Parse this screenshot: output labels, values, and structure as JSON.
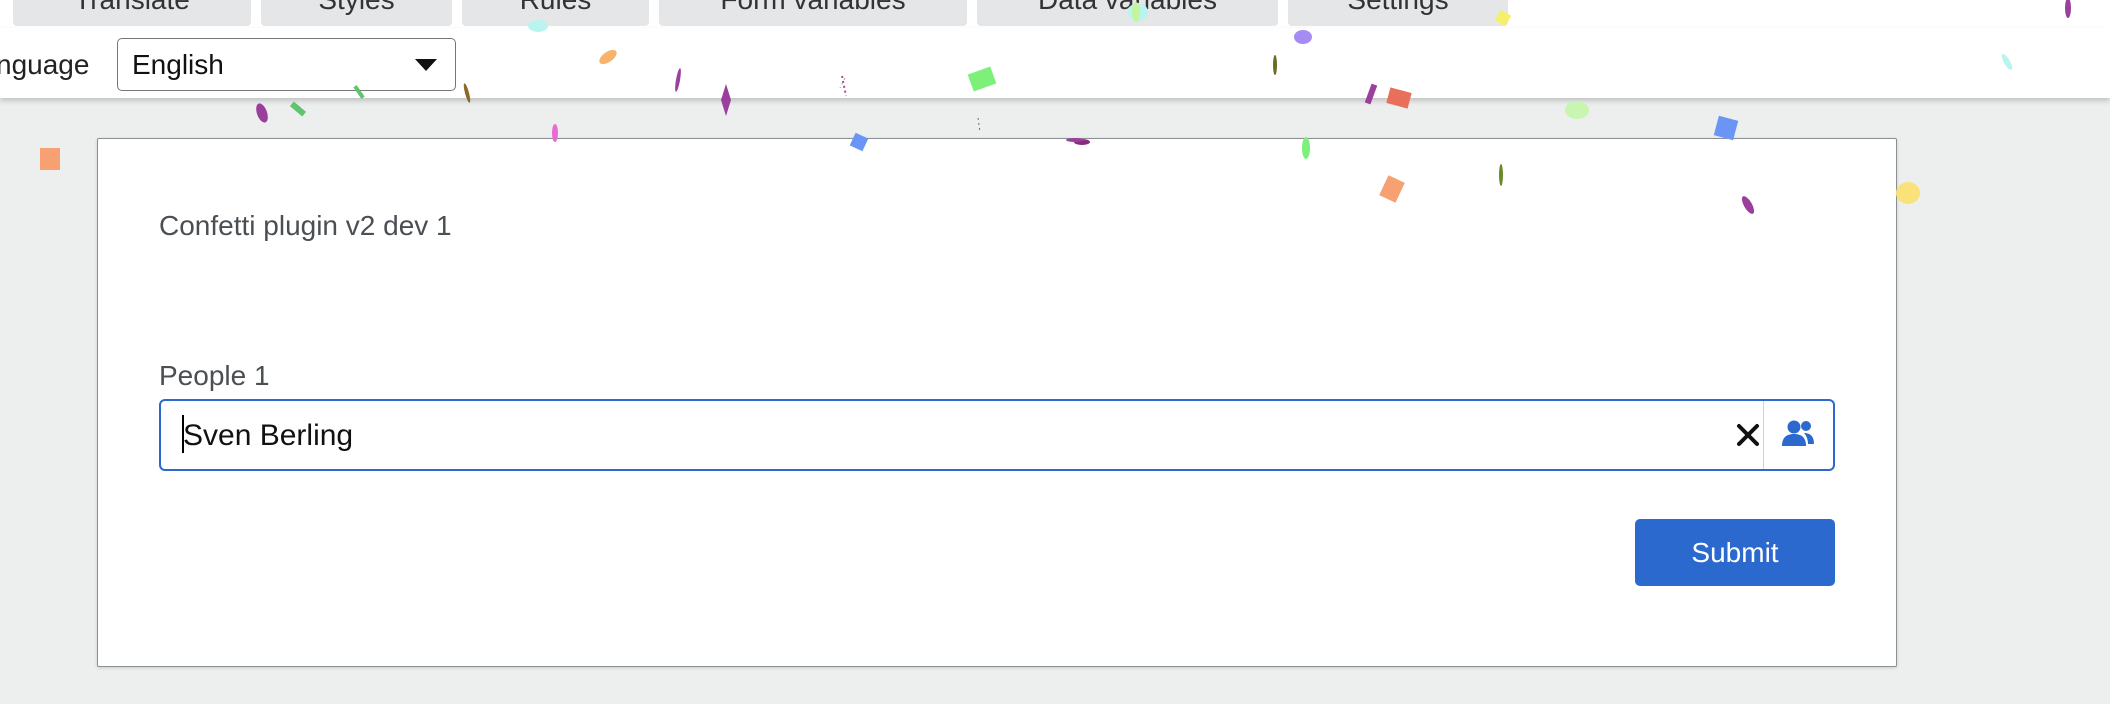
{
  "tabs": [
    {
      "label": "Translate"
    },
    {
      "label": "Styles"
    },
    {
      "label": "Rules"
    },
    {
      "label": "Form variables"
    },
    {
      "label": "Data variables"
    },
    {
      "label": "Settings"
    }
  ],
  "language": {
    "label": "nguage",
    "selected": "English"
  },
  "form": {
    "title": "Confetti plugin v2 dev 1",
    "people_label": "People 1",
    "people_value": "Sven Berling",
    "submit_label": "Submit"
  },
  "colors": {
    "accent": "#2b69cf",
    "background": "#edeeee"
  },
  "icons": {
    "clear": "close-icon",
    "picker": "people-icon",
    "dropdown": "chevron-down-icon"
  }
}
